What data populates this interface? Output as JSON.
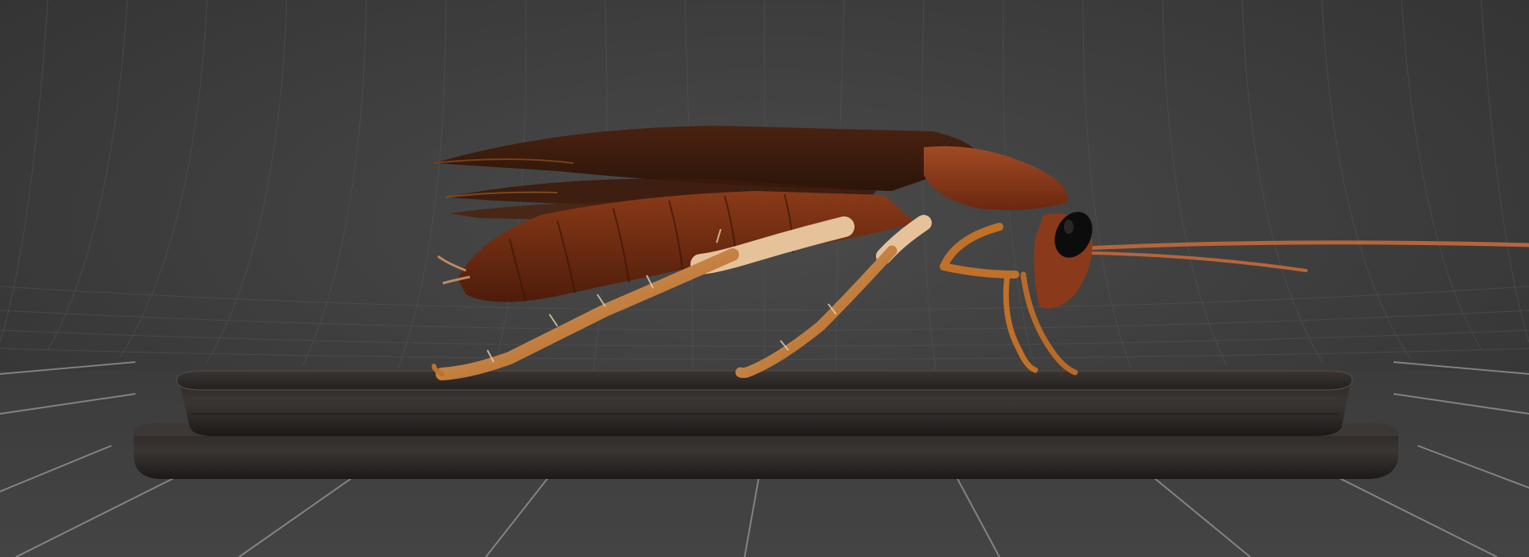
{
  "scene": {
    "subject": "cockroach-3d-model",
    "backdrop": "studio-grid-backdrop",
    "base": "display-pedestal"
  },
  "colors": {
    "backdrop": "#3d3d3d",
    "backdrop_glow": "#555555",
    "grid_line": "#5c5c5c",
    "floor_line": "#8a8a8a",
    "pedestal_top": "#2e2a27",
    "pedestal_side": "#1f1c1a",
    "pedestal_edge": "#4a4541",
    "wing": "#3a1a0c",
    "wing_edge": "#9a5a20",
    "abdomen": "#6e2a12",
    "abdomen_light": "#8e3b18",
    "pronotum": "#8c3d1e",
    "leg": "#c07028",
    "leg_light": "#e5b888",
    "eye": "#0c0c0c",
    "antenna": "#c06a38"
  }
}
